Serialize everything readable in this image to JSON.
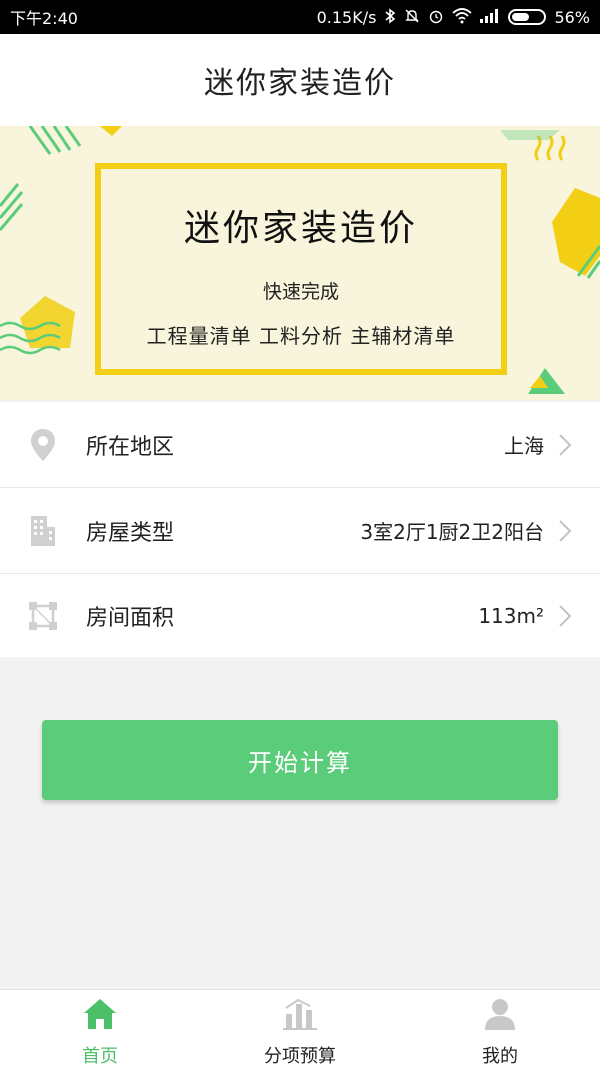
{
  "status_bar": {
    "time": "下午2:40",
    "network_speed": "0.15K/s",
    "battery_percent": "56%",
    "battery_level": 0.56
  },
  "header": {
    "title": "迷你家装造价"
  },
  "banner": {
    "title": "迷你家装造价",
    "subtitle": "快速完成",
    "features": "工程量清单  工料分析  主辅材清单"
  },
  "form": {
    "rows": [
      {
        "label": "所在地区",
        "value": "上海",
        "icon": "location-pin-icon"
      },
      {
        "label": "房屋类型",
        "value": "3室2厅1厨2卫2阳台",
        "icon": "building-icon"
      },
      {
        "label": "房间面积",
        "value": "113m²",
        "icon": "area-icon"
      }
    ]
  },
  "actions": {
    "start_label": "开始计算"
  },
  "bottom_nav": {
    "items": [
      {
        "label": "首页",
        "icon": "home-icon",
        "active": true
      },
      {
        "label": "分项预算",
        "icon": "chart-icon",
        "active": false
      },
      {
        "label": "我的",
        "icon": "user-icon",
        "active": false
      }
    ]
  },
  "colors": {
    "accent_green": "#5bcc7a",
    "banner_yellow": "#f2cf14",
    "banner_bg": "#f8f5dc"
  }
}
